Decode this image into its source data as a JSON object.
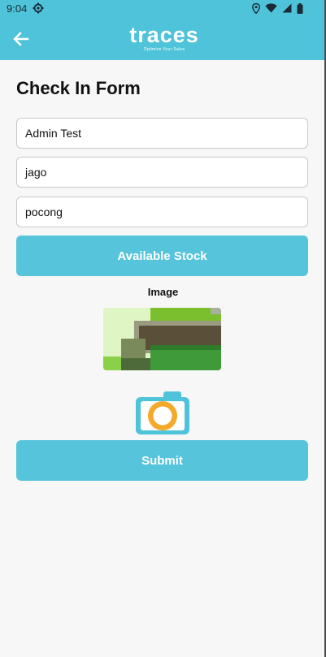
{
  "status_bar": {
    "time": "9:04"
  },
  "app_bar": {
    "brand_name": "traces",
    "brand_tagline": "Optimize Your Sales"
  },
  "form": {
    "title": "Check In Form",
    "fields": [
      {
        "value": "Admin Test"
      },
      {
        "value": "jago"
      },
      {
        "value": "pocong"
      }
    ],
    "available_stock_label": "Available Stock",
    "image_label": "Image",
    "submit_label": "Submit"
  },
  "colors": {
    "primary": "#4fc3d9",
    "button": "#56c4da",
    "camera_body": "#4fc3d9",
    "camera_lens": "#f4a92a"
  },
  "icons": {
    "back": "arrow-left-icon",
    "camera": "camera-icon",
    "settings": "gear-icon",
    "location": "location-icon",
    "wifi": "wifi-icon",
    "signal": "signal-icon",
    "battery": "battery-icon"
  }
}
